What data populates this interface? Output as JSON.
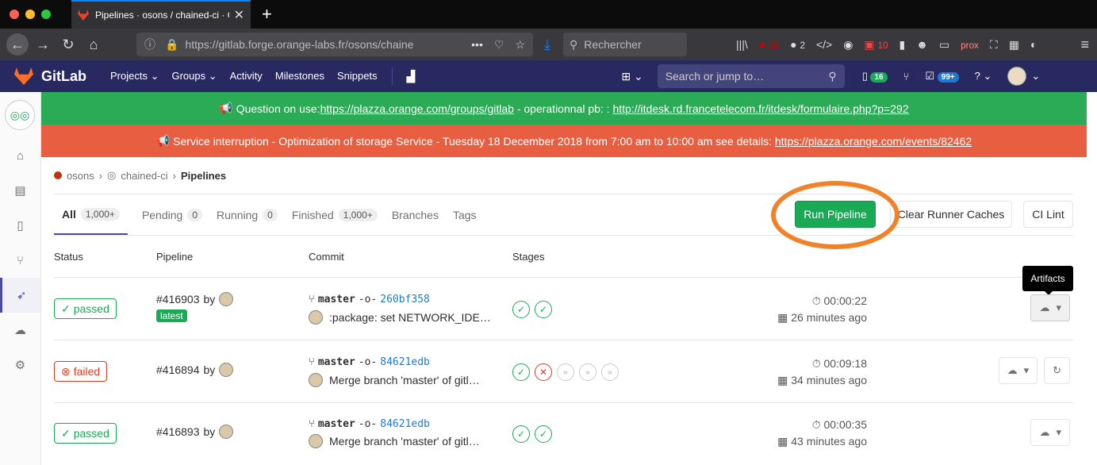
{
  "browser": {
    "tab_title": "Pipelines · osons / chained-ci · G",
    "url": "https://gitlab.forge.orange-labs.fr/osons/chaine",
    "search_placeholder": "Rechercher",
    "badges": {
      "ublock": "33",
      "count2": "2",
      "count10": "10",
      "prox": "prox"
    }
  },
  "gitlab_header": {
    "brand": "GitLab",
    "nav": [
      "Projects",
      "Groups",
      "Activity",
      "Milestones",
      "Snippets"
    ],
    "search_placeholder": "Search or jump to…",
    "mr_count": "16",
    "todo_count": "99+"
  },
  "banners": {
    "info_prefix": "Question on use: ",
    "info_link1": "https://plazza.orange.com/groups/gitlab",
    "info_middle": " - operationnal pb: : ",
    "info_link2": "http://itdesk.rd.francetelecom.fr/itdesk/formulaire.php?p=292",
    "warn_text": "Service interruption - Optimization of storage Service - Tuesday 18 December 2018 from 7:00 am to 10:00 am see details: ",
    "warn_link": "https://plazza.orange.com/events/82462"
  },
  "breadcrumb": {
    "group": "osons",
    "project": "chained-ci",
    "current": "Pipelines"
  },
  "tabs": [
    {
      "label": "All",
      "count": "1,000+"
    },
    {
      "label": "Pending",
      "count": "0"
    },
    {
      "label": "Running",
      "count": "0"
    },
    {
      "label": "Finished",
      "count": "1,000+"
    },
    {
      "label": "Branches",
      "count": ""
    },
    {
      "label": "Tags",
      "count": ""
    }
  ],
  "actions": {
    "run": "Run Pipeline",
    "clear": "Clear Runner Caches",
    "lint": "CI Lint"
  },
  "table_headers": {
    "status": "Status",
    "pipeline": "Pipeline",
    "commit": "Commit",
    "stages": "Stages"
  },
  "tooltip": "Artifacts",
  "rows": [
    {
      "status": "passed",
      "id": "#416903",
      "by": "by",
      "latest": "latest",
      "branch": "master",
      "sha": "260bf358",
      "message": ":package: set NETWORK_IDE…",
      "duration": "00:00:22",
      "ago": "26 minutes ago"
    },
    {
      "status": "failed",
      "id": "#416894",
      "by": "by",
      "latest": "",
      "branch": "master",
      "sha": "84621edb",
      "message": "Merge branch 'master' of gitl…",
      "duration": "00:09:18",
      "ago": "34 minutes ago"
    },
    {
      "status": "passed",
      "id": "#416893",
      "by": "by",
      "latest": "",
      "branch": "master",
      "sha": "84621edb",
      "message": "Merge branch 'master' of gitl…",
      "duration": "00:00:35",
      "ago": "43 minutes ago"
    }
  ],
  "colors": {
    "header": "#292961",
    "success": "#1aaa55",
    "danger": "#db3b21",
    "highlight": "#f08329"
  }
}
